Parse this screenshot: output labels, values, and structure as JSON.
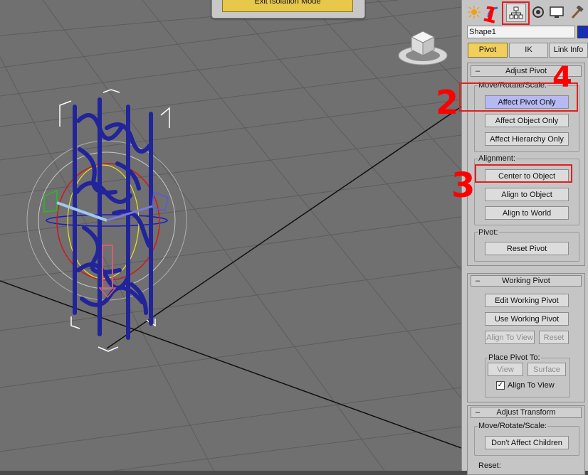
{
  "isolation": {
    "button_label": "Exit Isolation Mode"
  },
  "tabs": [
    {
      "name": "create-tab",
      "icon": "sun-star-icon"
    },
    {
      "name": "modify-tab",
      "icon": "modifier-bend-icon"
    },
    {
      "name": "hierarchy-tab",
      "icon": "hierarchy-icon"
    },
    {
      "name": "motion-tab",
      "icon": "motion-circle-icon"
    },
    {
      "name": "display-tab",
      "icon": "monitor-icon"
    },
    {
      "name": "utilities-tab",
      "icon": "hammer-icon"
    }
  ],
  "object": {
    "name": "Shape1",
    "color": "#1a2fb0"
  },
  "modes": {
    "pivot": "Pivot",
    "ik": "IK",
    "link_info": "Link Info"
  },
  "adjust_pivot": {
    "header": "Adjust Pivot",
    "move_group": "Move/Rotate/Scale:",
    "affect_pivot_only": "Affect Pivot Only",
    "affect_object_only": "Affect Object Only",
    "affect_hierarchy_only": "Affect Hierarchy Only",
    "alignment_group": "Alignment:",
    "center_to_object": "Center to Object",
    "align_to_object": "Align to Object",
    "align_to_world": "Align to World",
    "pivot_group": "Pivot:",
    "reset_pivot": "Reset Pivot"
  },
  "working_pivot": {
    "header": "Working Pivot",
    "edit": "Edit Working Pivot",
    "use": "Use Working Pivot",
    "align_to_view": "Align To View",
    "reset": "Reset",
    "place_group": "Place Pivot To:",
    "view": "View",
    "surface": "Surface",
    "align_to_view_check": "Align To View",
    "align_to_view_checked": true
  },
  "adjust_transform": {
    "header": "Adjust Transform",
    "move_group": "Move/Rotate/Scale:",
    "dont_affect_children": "Don't Affect Children",
    "reset_group": "Reset:"
  },
  "annotations": {
    "a1": "1",
    "a2": "2",
    "a3": "3",
    "a4": "4"
  },
  "colors": {
    "highlight": "#b6b9f2",
    "active_mode": "#f0cf5a",
    "annotation": "#ff0000"
  }
}
